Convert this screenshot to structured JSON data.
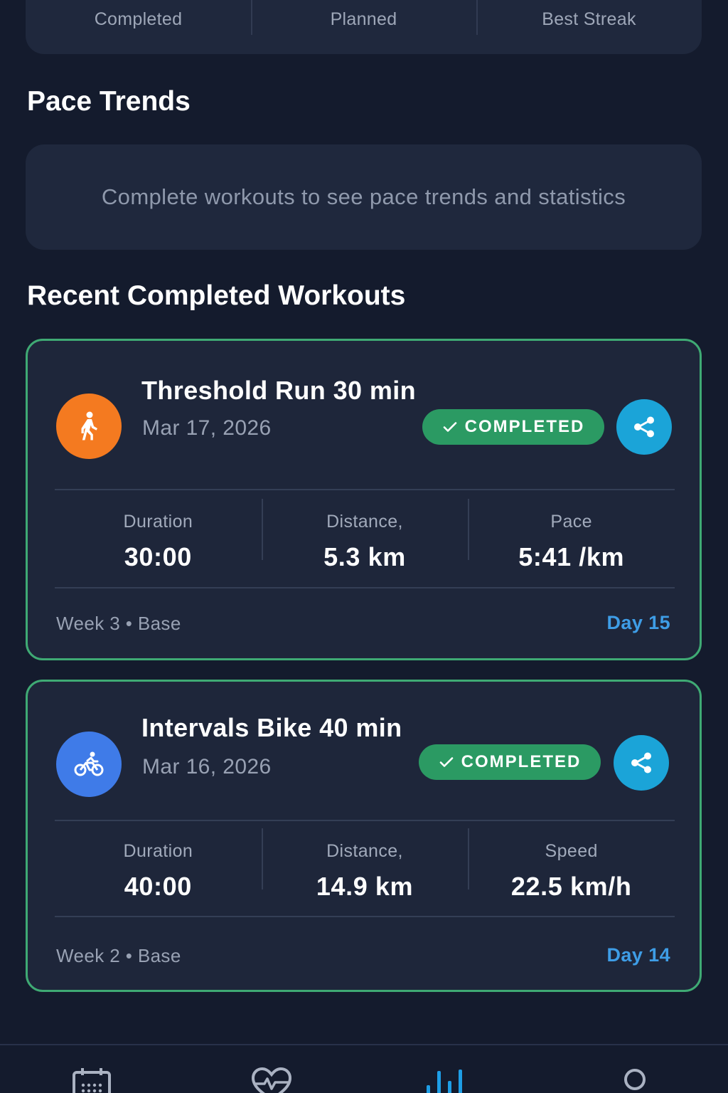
{
  "summary": {
    "cells": [
      {
        "label": "Completed"
      },
      {
        "label": "Planned"
      },
      {
        "label": "Best Streak"
      }
    ]
  },
  "pace_trends": {
    "title": "Pace Trends",
    "empty_message": "Complete workouts to see pace trends and statistics"
  },
  "recent": {
    "title": "Recent Completed Workouts",
    "workouts": [
      {
        "icon": "walk-icon",
        "icon_color": "#f47a20",
        "title": "Threshold Run 30 min",
        "date": "Mar 17, 2026",
        "status": "COMPLETED",
        "stats": [
          {
            "label": "Duration",
            "value": "30:00"
          },
          {
            "label": "Distance,",
            "value": "5.3 km"
          },
          {
            "label": "Pace",
            "value": "5:41 /km"
          }
        ],
        "meta": "Week 3 • Base",
        "day": "Day 15"
      },
      {
        "icon": "bike-icon",
        "icon_color": "#3f7be8",
        "title": "Intervals Bike 40 min",
        "date": "Mar 16, 2026",
        "status": "COMPLETED",
        "stats": [
          {
            "label": "Duration",
            "value": "40:00"
          },
          {
            "label": "Distance,",
            "value": "14.9 km"
          },
          {
            "label": "Speed",
            "value": "22.5 km/h"
          }
        ],
        "meta": "Week 2 • Base",
        "day": "Day 14"
      }
    ]
  },
  "colors": {
    "background": "#141b2d",
    "card": "#1f283d",
    "completed_green": "#2b9a63",
    "card_border_green": "#3faa74",
    "share_blue": "#1ba4d8",
    "day_blue": "#3e9de6",
    "active_tab": "#1e9ee6"
  },
  "nav": {
    "items": [
      {
        "icon": "calendar-icon",
        "active": false
      },
      {
        "icon": "heart-pulse-icon",
        "active": false
      },
      {
        "icon": "bar-chart-icon",
        "active": true
      },
      {
        "icon": "profile-icon",
        "active": false
      }
    ]
  }
}
